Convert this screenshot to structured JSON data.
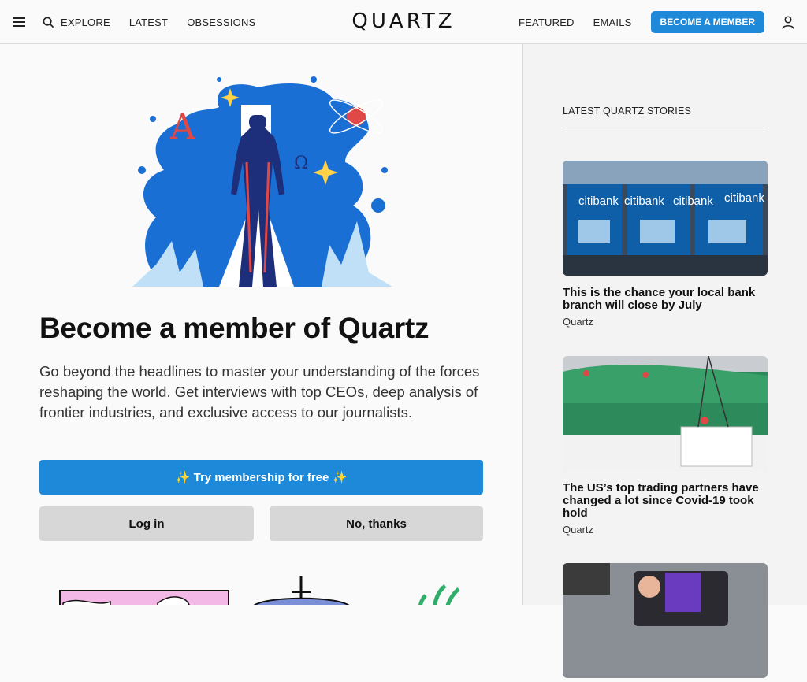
{
  "header": {
    "nav_left": [
      "EXPLORE",
      "LATEST",
      "OBSESSIONS"
    ],
    "logo": "QUARTZ",
    "nav_right": [
      "FEATURED",
      "EMAILS"
    ],
    "cta": "BECOME A MEMBER"
  },
  "main": {
    "title": "Become a member of Quartz",
    "description": "Go beyond the headlines to master your understanding of the forces reshaping the world. Get interviews with top CEOs, deep analysis of frontier industries, and exclusive access to our journalists.",
    "try_button": "✨ Try membership for free ✨",
    "login_button": "Log in",
    "no_thanks_button": "No, thanks"
  },
  "sidebar": {
    "heading": "LATEST QUARTZ STORIES",
    "stories": [
      {
        "headline": "This is the chance your local bank branch will close by July",
        "source": "Quartz"
      },
      {
        "headline": "The US’s top trading partners have changed a lot since Covid-19 took hold",
        "source": "Quartz"
      }
    ]
  },
  "colors": {
    "accent": "#1e88d9",
    "secondary_button": "#d7d7d7"
  }
}
